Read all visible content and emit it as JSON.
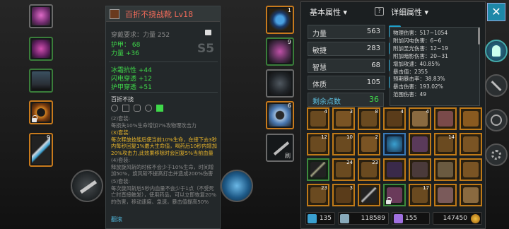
{
  "tooltip": {
    "title": "百折不挠战靴  Lv18",
    "requirement_label": "穿戴要求：",
    "requirement_value": "力量 252",
    "grade": "S5",
    "base_stats": [
      "护甲：   68",
      "力量  +36"
    ],
    "bonus_stats": [
      "冰霜抗性 +44",
      "闪电穿透 +12",
      "护甲穿透 +51"
    ],
    "set_name": "百折不挠",
    "set_desc_1": "(2)套装:\n每损失10%生命增加7%攻物理攻击力",
    "set_desc_3": "(3)套装:\n每次释放技能后使当前10%生命，在接下去3秒内每秒回复1%最大生命值，喝药后10秒内增加20%攻击力,此效果移除时会回复5%当前血量",
    "set_desc_4": "(4)套装:\n释放旋风斩的时候不会少于10%生命，时间增加50%，旋风斩不提高打击并造成200%伤害",
    "set_desc_5": "(5)套装:\n每次旋风斩后5秒内血量不会少于1点（不受死亡时直接触发），使用药品，可以立即恢复20%的伤害，移动速度、急速，暴击值提高50%",
    "footer": "翻滚"
  },
  "stats_panel": {
    "tab_basic": "基本属性",
    "tab_detail": "详细属性",
    "attributes": [
      {
        "label": "力量",
        "value": "563"
      },
      {
        "label": "敏捷",
        "value": "283"
      },
      {
        "label": "智慧",
        "value": "68"
      },
      {
        "label": "体质",
        "value": "105"
      }
    ],
    "remaining_label": "剩余点数",
    "remaining_value": "36",
    "details": [
      "物理伤害：517~1054",
      "附加闪电伤害：6~6",
      "附加圣光伤害：12~19",
      "附加暗影伤害：20~31",
      "增加攻速：40.85%",
      "暴击值：2355",
      "预期暴击率：38.83%",
      "暴击伤害：193.02%",
      "范围伤害：49"
    ]
  },
  "inventory_counts": [
    "4",
    "3",
    "8",
    "4",
    "4",
    "12",
    "10",
    "2",
    "14",
    "24",
    "23",
    "23",
    "3",
    "17"
  ],
  "resources": [
    {
      "name": "gems",
      "value": "135"
    },
    {
      "name": "fragments",
      "value": "118589"
    },
    {
      "name": "crystals",
      "value": "155"
    },
    {
      "name": "gold",
      "value": "147450"
    }
  ],
  "colors": {
    "rare": "#c87a1c",
    "uncommon": "#3a7d3a",
    "magic": "#3a7ab8",
    "accent": "#1f9fc9",
    "title": "#f26b5a",
    "green_stat": "#3fd94a",
    "set_yellow": "#e7b42a"
  }
}
